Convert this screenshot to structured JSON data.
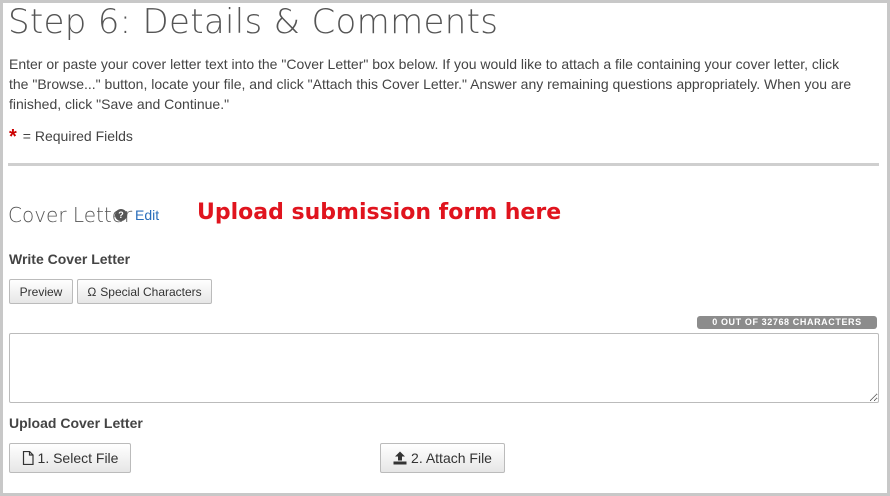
{
  "header": {
    "title": "Step 6: Details & Comments",
    "instructions": "Enter or paste your cover letter text into the \"Cover Letter\" box below. If you would like to attach a file containing your cover letter, click the \"Browse...\" button, locate your file, and click \"Attach this Cover Letter.\" Answer any remaining questions appropriately. When you are finished, click \"Save and Continue.\"",
    "required_marker": "*",
    "required_label": "= Required Fields"
  },
  "cover_letter": {
    "title": "Cover Letter",
    "help_icon": "?",
    "edit_label": "Edit",
    "annotation": "Upload submission form here",
    "write_heading": "Write Cover Letter",
    "preview_label": "Preview",
    "special_chars_symbol": "Ω",
    "special_chars_label": "Special Characters",
    "char_counter": "0 OUT OF 32768 CHARACTERS",
    "textarea_value": "",
    "upload_heading": "Upload Cover Letter",
    "select_file_label": "1. Select File",
    "attach_file_label": "2. Attach File"
  },
  "icons": {
    "help": "question-circle-icon",
    "special_chars": "omega-icon",
    "select_file": "file-icon",
    "attach_file": "upload-icon"
  },
  "colors": {
    "annotation": "#e0141e",
    "link": "#2a6ebb",
    "required_star": "#cc0000",
    "counter_badge": "#8c8c8c"
  }
}
